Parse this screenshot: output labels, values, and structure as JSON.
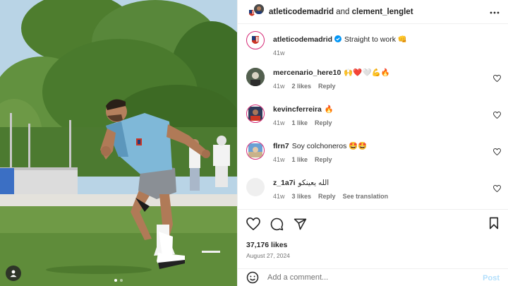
{
  "header": {
    "username": "atleticodemadrid",
    "conjunction": " and ",
    "collaborator": "clement_lenglet"
  },
  "caption": {
    "username": "atleticodemadrid",
    "text": "Straight to work 👊",
    "time": "41w"
  },
  "comments": [
    {
      "username": "mercenario_here10",
      "text": "🙌❤️🤍💪🔥",
      "time": "41w",
      "likes": "2 likes",
      "reply": "Reply",
      "extra": ""
    },
    {
      "username": "kevincferreira",
      "text": "🔥",
      "time": "41w",
      "likes": "1 like",
      "reply": "Reply",
      "extra": ""
    },
    {
      "username": "flrn7",
      "text": "Soy colchoneros 🤩🤩",
      "time": "41w",
      "likes": "1 like",
      "reply": "Reply",
      "extra": ""
    },
    {
      "username": "z_1a7i",
      "text": "الله يعينكو",
      "time": "41w",
      "likes": "3 likes",
      "reply": "Reply",
      "extra": "See translation"
    }
  ],
  "post": {
    "likes": "37,176 likes",
    "date": "August 27, 2024"
  },
  "composer": {
    "placeholder": "Add a comment...",
    "post_label": "Post"
  },
  "carousel": {
    "count": 2,
    "active": 1
  },
  "colors": {
    "ring": "#d62976",
    "verified": "#0095f6",
    "post_disabled": "#b2dffc",
    "athletico_red": "#cb3524",
    "athletico_blue": "#1e3b7a"
  },
  "icons": [
    "more-icon",
    "heart-icon",
    "comment-icon",
    "share-icon",
    "bookmark-icon",
    "emoji-icon",
    "user-tag-icon",
    "verified-icon"
  ]
}
